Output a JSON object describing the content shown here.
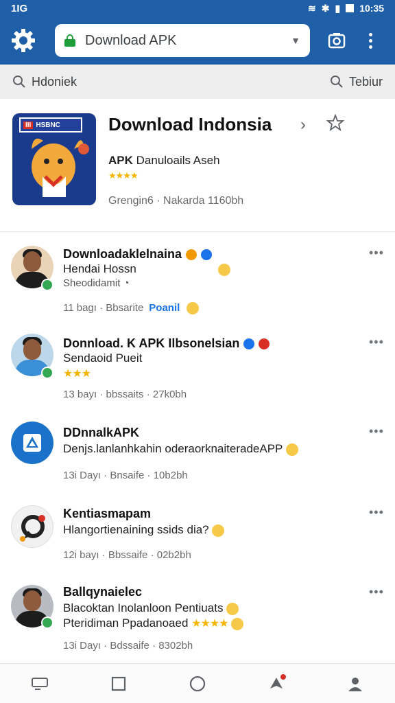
{
  "status_bar": {
    "left": "1IG",
    "time": "10:35"
  },
  "app_bar": {
    "url_text": "Download APK"
  },
  "search_row": {
    "left_label": "Hdoniek",
    "right_label": "Tebiur"
  },
  "featured": {
    "title": "Download Indonsia",
    "logo_text": "HSBNC",
    "subtitle_bold": "APK",
    "subtitle_rest": " Danuloails Aseh",
    "rating_stars": "★★★★",
    "meta": "Grengin6 · Nakarda  1160bh"
  },
  "posts": [
    {
      "name": "Downloadaklelnaina",
      "line1": "Hendai Hossn",
      "line2": "Sheodidamit",
      "meta": "11 bagı · Bbsarite",
      "meta_link": "Poanil"
    },
    {
      "name": "Donnload. K APK Ilbsonelsian",
      "line1": "Sendaoid Pueit",
      "stars": "★★★",
      "meta": "13 bayı · bbssaits · 27k0bh"
    },
    {
      "name": "DDnnalkAPK",
      "line1": "Denjs.lanlanhkahin oderaorknaiteradeAPP",
      "meta": "13i Dayı · Bnsaife · 10b2bh"
    },
    {
      "name": "Kentiasmapam",
      "line1": "Hlangortienaining ssids dia?",
      "meta": "12i bayı · Bbssaife · 02b2bh"
    },
    {
      "name": "Ballqynaielec",
      "line1": "Blacoktan Inolanloon Pentiuats",
      "line2": "Pteridiman Ppadanoaed",
      "line2_stars": "★★★★",
      "meta": "13i Dayı · Bdssaife · 8302bh"
    }
  ],
  "colors": {
    "primary": "#1f5fa8",
    "link": "#1a73e8",
    "star": "#f4b400",
    "online": "#34a853"
  }
}
